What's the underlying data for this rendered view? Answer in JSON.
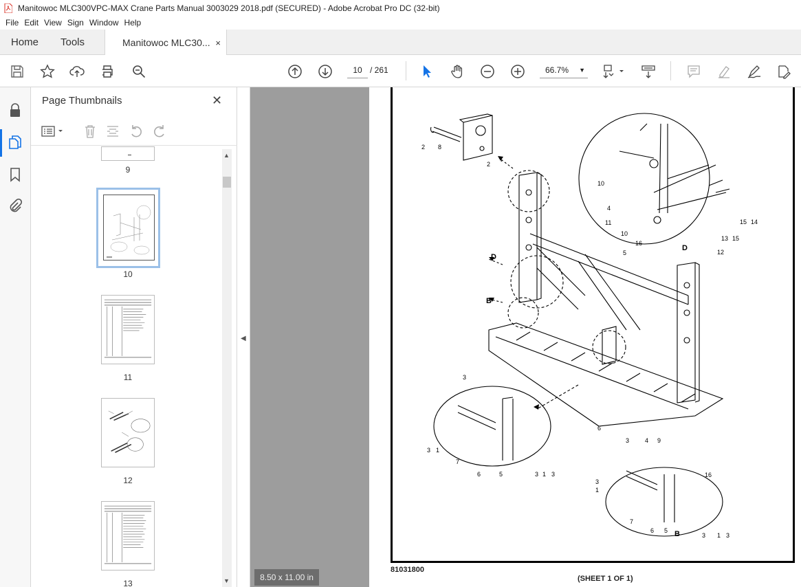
{
  "window": {
    "title": "Manitowoc MLC300VPC-MAX Crane Parts Manual 3003029 2018.pdf (SECURED) - Adobe Acrobat Pro DC (32-bit)"
  },
  "menu": [
    "File",
    "Edit",
    "View",
    "Sign",
    "Window",
    "Help"
  ],
  "tabs": {
    "home": "Home",
    "tools": "Tools",
    "doc": "Manitowoc MLC30...",
    "close": "×"
  },
  "toolbar": {
    "current_page": "10",
    "total_pages": "/   261",
    "zoom": "66.7%",
    "icons": [
      "save-icon",
      "star-icon",
      "upload-icon",
      "print-icon",
      "zoom-search-icon",
      "prev-page-icon",
      "next-page-icon",
      "select-cursor-icon",
      "hand-icon",
      "zoom-out-icon",
      "zoom-in-icon",
      "fit-page-icon",
      "scroll-mode-icon",
      "comment-icon",
      "highlight-icon",
      "sign-icon",
      "edit-icon"
    ]
  },
  "panel": {
    "title": "Page Thumbnails",
    "close": "✕",
    "thumbs": [
      {
        "label": "9"
      },
      {
        "label": "10"
      },
      {
        "label": "11"
      },
      {
        "label": "12"
      },
      {
        "label": "13"
      }
    ]
  },
  "document": {
    "page_size": "8.50 x 11.00 in",
    "drawing_number": "81031800",
    "sheet": "(SHEET 1 OF 1)",
    "callouts": {
      "d_label": "D",
      "b_label": "B"
    }
  }
}
